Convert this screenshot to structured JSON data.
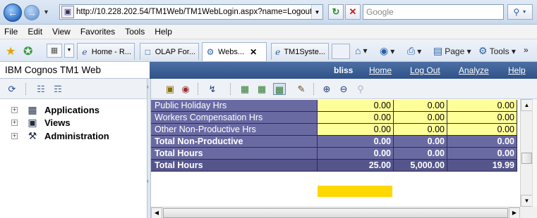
{
  "browser": {
    "url": "http://10.228.202.54/TM1Web/TM1WebLogin.aspx?name=Logout",
    "search_placeholder": "Google",
    "menu": [
      "File",
      "Edit",
      "View",
      "Favorites",
      "Tools",
      "Help"
    ],
    "tabs": [
      {
        "label": "Home - R...",
        "active": false
      },
      {
        "label": "OLAP For...",
        "active": false
      },
      {
        "label": "Webs...",
        "active": true
      },
      {
        "label": "TM1Syste...",
        "active": false
      }
    ],
    "commands": {
      "page": "Page",
      "tools": "Tools"
    }
  },
  "tm1": {
    "title": "IBM Cognos TM1 Web",
    "user": "bliss",
    "nav": {
      "home": "Home",
      "logout": "Log Out",
      "analyze": "Analyze",
      "help": "Help"
    },
    "tree": [
      {
        "label": "Applications",
        "icon": "applications-icon"
      },
      {
        "label": "Views",
        "icon": "views-icon"
      },
      {
        "label": "Administration",
        "icon": "administration-icon"
      }
    ],
    "grid_rows": [
      {
        "label": "Public Holiday Hrs",
        "kind": "data",
        "values": [
          "0.00",
          "0.00",
          "0.00"
        ]
      },
      {
        "label": "Workers Compensation Hrs",
        "kind": "data",
        "values": [
          "0.00",
          "0.00",
          "0.00"
        ]
      },
      {
        "label": "Other Non-Productive Hrs",
        "kind": "data",
        "values": [
          "0.00",
          "0.00",
          "0.00"
        ]
      },
      {
        "label": "Total Non-Productive",
        "kind": "total",
        "values": [
          "0.00",
          "0.00",
          "0.00"
        ]
      },
      {
        "label": "Total Hours",
        "kind": "total",
        "values": [
          "0.00",
          "0.00",
          "0.00"
        ]
      },
      {
        "label": "Total Hours",
        "kind": "grand",
        "values": [
          "25.00",
          "5,000.00",
          "19.99"
        ]
      }
    ]
  },
  "colors": {
    "header_bar": "#2f5288",
    "row_label": "#6a6aa3",
    "data_cell": "#ffff99",
    "highlight_bar": "#ffd800"
  }
}
